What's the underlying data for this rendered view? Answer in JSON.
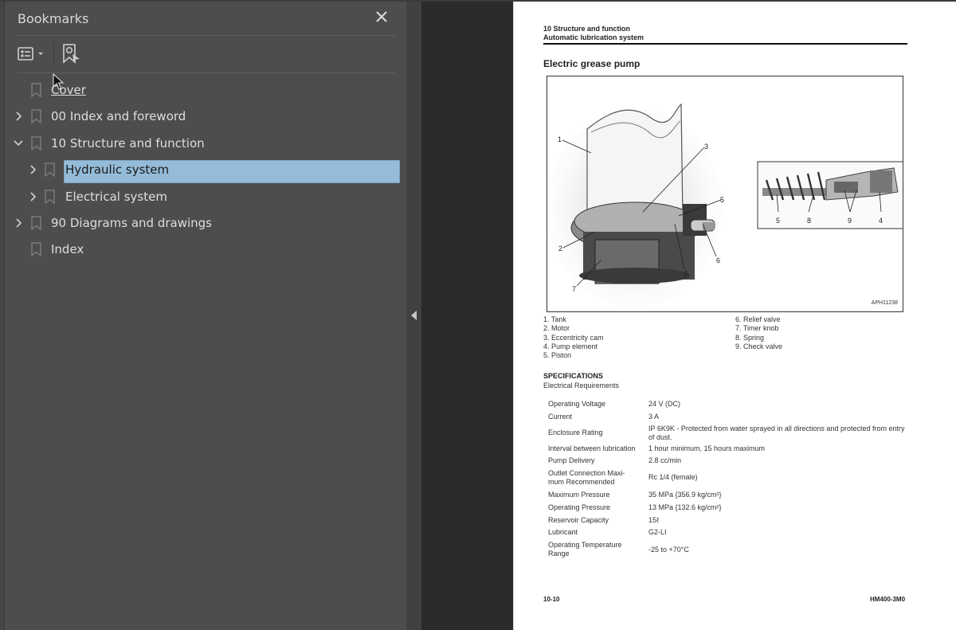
{
  "sidebar": {
    "title": "Bookmarks",
    "close_icon": "close-icon",
    "toolbar": {
      "options_icon": "list-options-icon",
      "find_bookmark_icon": "find-current-bookmark-icon"
    },
    "items": [
      {
        "label": "Cover",
        "level": 0,
        "expandable": false,
        "expanded": false,
        "selected": false,
        "link_style": true
      },
      {
        "label": "00 Index and foreword",
        "level": 0,
        "expandable": true,
        "expanded": false,
        "selected": false
      },
      {
        "label": "10 Structure and function",
        "level": 0,
        "expandable": true,
        "expanded": true,
        "selected": false
      },
      {
        "label": "Hydraulic system",
        "level": 1,
        "expandable": true,
        "expanded": false,
        "selected": true
      },
      {
        "label": "Electrical system",
        "level": 1,
        "expandable": true,
        "expanded": false,
        "selected": false
      },
      {
        "label": "90 Diagrams and drawings",
        "level": 0,
        "expandable": true,
        "expanded": false,
        "selected": false
      },
      {
        "label": "Index",
        "level": 0,
        "expandable": false,
        "expanded": false,
        "selected": false
      }
    ],
    "selection_color": "#94bcd9"
  },
  "splitter": {
    "collapse_icon": "triangle-left-icon"
  },
  "page": {
    "header_line1": "10 Structure and function",
    "header_line2": "Automatic lubrication system",
    "title": "Electric grease pump",
    "figure_code": "APH11238",
    "figure_callouts_main": [
      "1",
      "2",
      "3",
      "4",
      "5",
      "6",
      "7"
    ],
    "figure_callouts_detail": [
      "5",
      "8",
      "9",
      "4"
    ],
    "legend_left": [
      "1. Tank",
      "2. Motor",
      "3. Eccentricity cam",
      "4. Pump element",
      "5. Piston"
    ],
    "legend_right": [
      "6. Relief valve",
      "7. Timer knob",
      "8. Spring",
      "9. Check valve"
    ],
    "specs_heading": "SPECIFICATIONS",
    "specs_subheading": "Electrical Requirements",
    "specs": [
      {
        "key": "Operating Voltage",
        "value": "24 V (DC)"
      },
      {
        "key": "Current",
        "value": "3 A"
      },
      {
        "key": "Enclosure Rating",
        "value": "IP 6K9K - Protected from water sprayed in all directions and protected from entry of dust."
      },
      {
        "key": "Interval between lubrication",
        "value": "1 hour minimum, 15 hours maximum"
      },
      {
        "key": "Pump Delivery",
        "value": "2.8 cc/min"
      },
      {
        "key": "Outlet Connection Maxi-mum Recommended",
        "value": "Rc 1/4 (female)"
      },
      {
        "key": "Maximum Pressure",
        "value": "35 MPa {356.9 kg/cm²}"
      },
      {
        "key": "Operating Pressure",
        "value": "13 MPa {132.6 kg/cm²}"
      },
      {
        "key": "Reservoir Capacity",
        "value": "15ℓ"
      },
      {
        "key": "Lubricant",
        "value": "G2-LI"
      },
      {
        "key": "Operating Temperature Range",
        "value": "-25 to +70°C"
      }
    ],
    "footer_left": "10-10",
    "footer_right": "HM400-3M0"
  }
}
